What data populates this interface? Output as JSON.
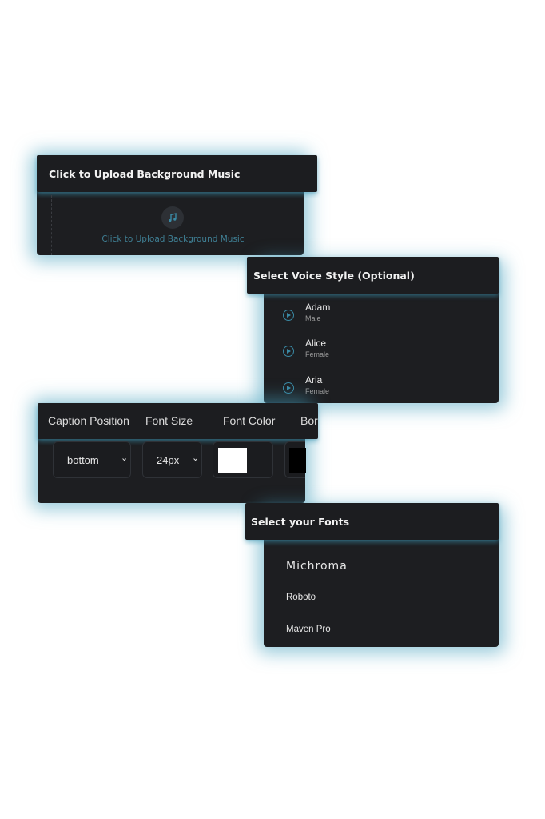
{
  "upload_card": {
    "header": "Click to Upload Background Music",
    "drop_text": "Click to Upload Background Music",
    "icon": "music-note-icon"
  },
  "voice_card": {
    "header": "Select Voice Style (Optional)",
    "voices": [
      {
        "name": "Adam",
        "gender": "Male"
      },
      {
        "name": "Alice",
        "gender": "Female"
      },
      {
        "name": "Aria",
        "gender": "Female"
      }
    ]
  },
  "caption_card": {
    "headers": [
      "Caption Position",
      "Font Size",
      "Font Color",
      "Bor"
    ],
    "position_value": "bottom",
    "size_value": "24px",
    "font_color": "#ffffff",
    "border_color": "#000000"
  },
  "fonts_card": {
    "header": "Select your Fonts",
    "fonts": [
      "Michroma",
      "Roboto",
      "Maven Pro"
    ]
  },
  "colors": {
    "accent": "#3a8aa5",
    "card_bg": "#1d1e21",
    "glow": "#46a0be"
  }
}
